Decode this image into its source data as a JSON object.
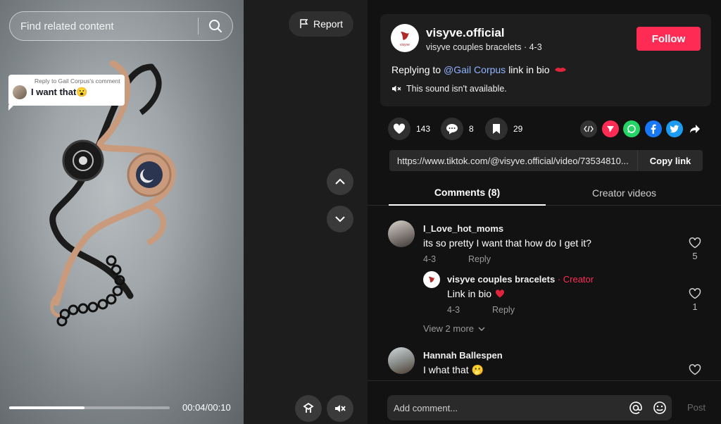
{
  "video": {
    "search_placeholder": "Find related content",
    "reply_bubble": {
      "small": "Reply to Gail Corpus's comment",
      "big": "I want that😮"
    },
    "progress_fraction": 0.47,
    "time": "00:04/00:10"
  },
  "report_label": "Report",
  "post_info": {
    "username": "visyve.official",
    "subline": "visyve couples bracelets · 4-3",
    "follow_label": "Follow",
    "caption_prefix": "Replying to",
    "mention": "@Gail Corpus",
    "caption_rest": "link in bio",
    "sound": "This sound isn't available."
  },
  "stats": {
    "likes": "143",
    "comments": "8",
    "saves": "29"
  },
  "link": {
    "url": "https://www.tiktok.com/@visyve.official/video/73534810...",
    "copy_label": "Copy link"
  },
  "tabs": [
    {
      "label": "Comments (8)",
      "active": true
    },
    {
      "label": "Creator videos",
      "active": false
    }
  ],
  "comments": [
    {
      "name": "I_Love_hot_moms",
      "text": "its so pretty I want that how do I get it?",
      "date": "4-3",
      "reply": "Reply",
      "likes": "5"
    },
    {
      "name": "Hannah Ballespen",
      "text": "I what that 🫢",
      "date": "",
      "reply": "",
      "likes": ""
    }
  ],
  "reply": {
    "name": "visyve couples bracelets",
    "creator_tag": " · Creator",
    "text": "Link in bio",
    "date": "4-3",
    "reply": "Reply",
    "likes": "1"
  },
  "view_more": "View 2 more",
  "add_comment_placeholder": "Add comment...",
  "post_label": "Post",
  "brand_logo_text": "visyve",
  "colors": {
    "accent": "#fe2c55",
    "mention": "#8fb3ff"
  }
}
